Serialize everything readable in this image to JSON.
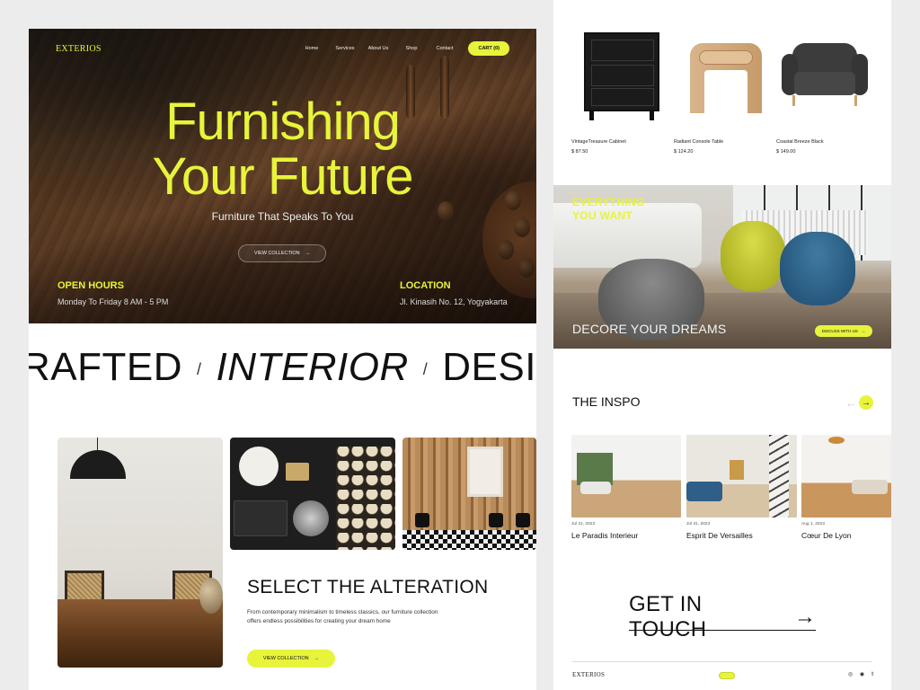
{
  "brand": "EXTERIOS",
  "nav": {
    "links": [
      "Home",
      "Services",
      "About Us",
      "Shop",
      "Contact"
    ],
    "cart_label": "CART (0)"
  },
  "hero": {
    "title_line1": "Furnishing",
    "title_line2": "Your Future",
    "subtitle": "Furniture That Speaks To You",
    "cta_label": "VIEW COLLECTION",
    "open_hours_label": "OPEN HOURS",
    "open_hours_value": "Monday To Friday 8 AM - 5 PM",
    "location_label": "LOCATION",
    "location_value": "Jl. Kinasih No. 12, Yogyakarta"
  },
  "marquee": {
    "words": [
      "RAFTED",
      "INTERIOR",
      "DESIG"
    ],
    "separator": "/"
  },
  "alteration": {
    "title": "SELECT THE ALTERATION",
    "description": "From contemporary minimalism to timeless classics, our furniture collection offers endless possibilities for creating your dream home",
    "cta_label": "VIEW COLLECTION"
  },
  "products": [
    {
      "name": "VintageTreasure Cabinet",
      "price": "$ 87.50"
    },
    {
      "name": "Radiant Console Table",
      "price": "$ 124.20"
    },
    {
      "name": "Coastal Breeze Black",
      "price": "$ 149.00"
    }
  ],
  "banner": {
    "heading_line1": "EVERYTHING",
    "heading_line2": "YOU WANT",
    "tagline": "DECORE YOUR DREAMS",
    "cta_label": "DISCUSS WITH US"
  },
  "inspo": {
    "title": "THE INSPO",
    "cards": [
      {
        "date": "Jul 21, 2023",
        "title": "Le Paradis Interieur"
      },
      {
        "date": "Jul 31, 2023",
        "title": "Esprit De Versailles"
      },
      {
        "date": "Aug 1, 2023",
        "title": "Cœur De Lyon"
      }
    ]
  },
  "contact": {
    "label": "GET IN TOUCH"
  },
  "footer": {
    "brand": "EXTERIOS",
    "pill": "•••",
    "socials": "◎ ◉ 𝕥"
  },
  "colors": {
    "accent": "#e7f43b",
    "dark": "#111111",
    "bg": "#ececec"
  },
  "icons": {
    "arrow": "arrow-right-icon",
    "prev": "arrow-left-icon"
  }
}
